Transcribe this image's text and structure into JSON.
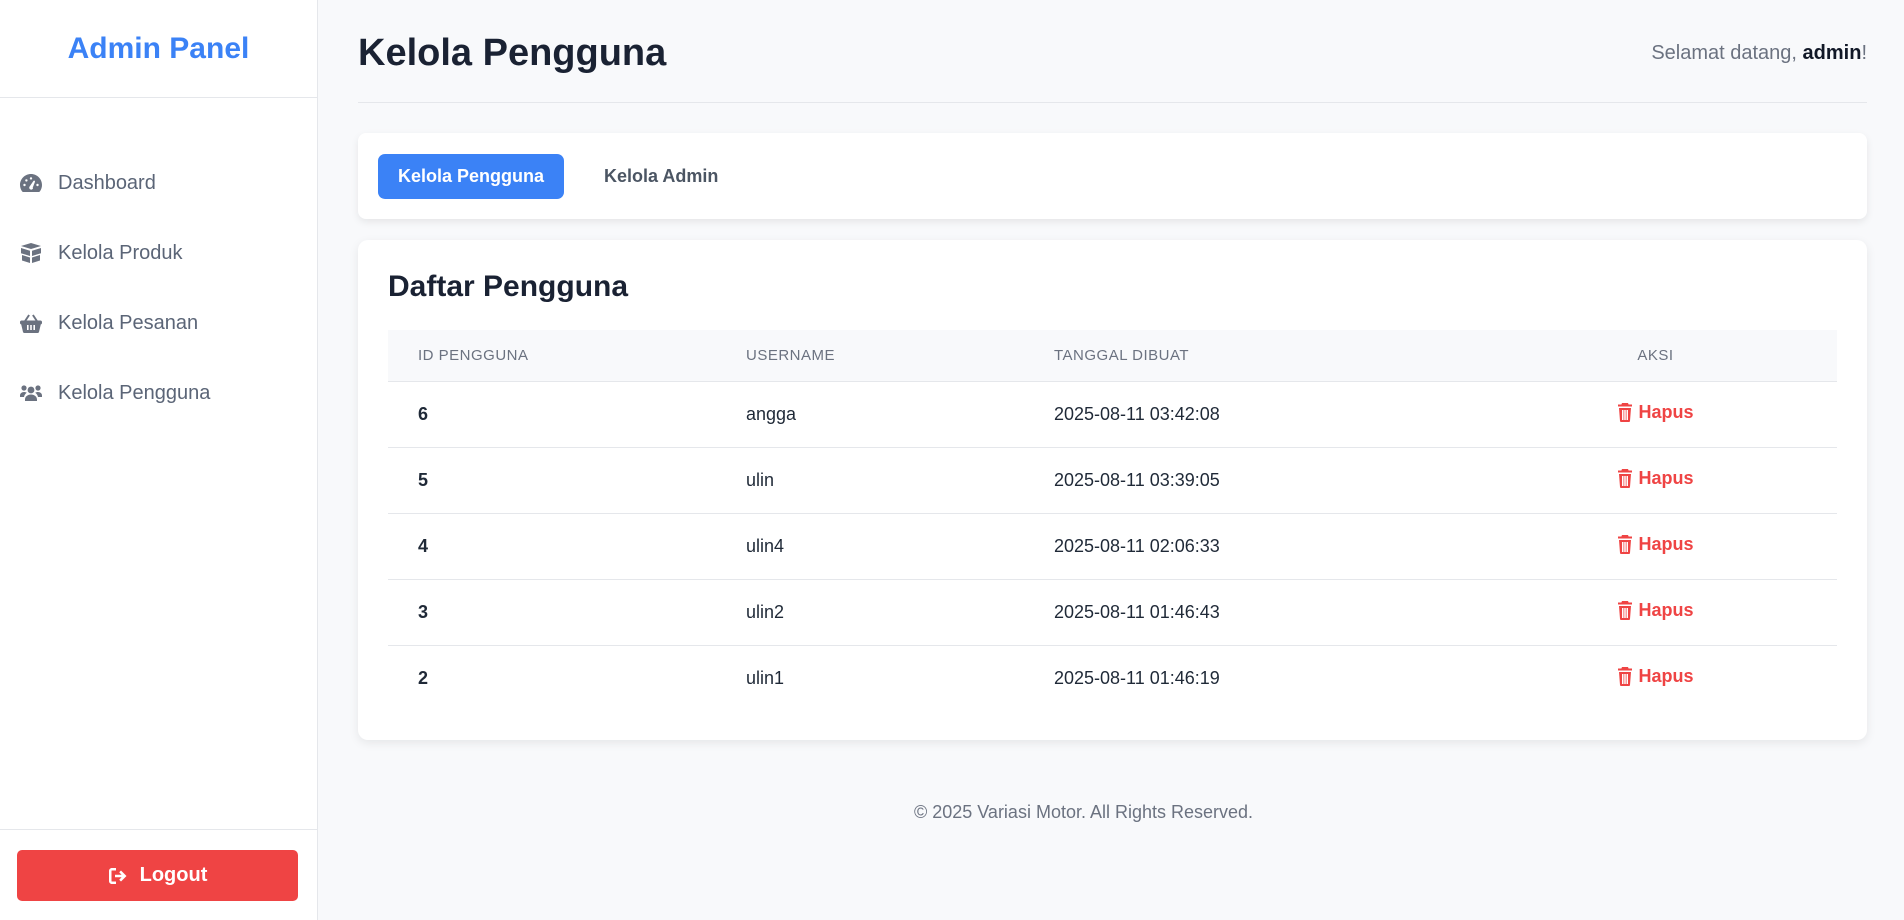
{
  "sidebar": {
    "brand": "Admin Panel",
    "items": [
      {
        "label": "Dashboard",
        "icon": "dashboard-gauge-icon"
      },
      {
        "label": "Kelola Produk",
        "icon": "box-icon"
      },
      {
        "label": "Kelola Pesanan",
        "icon": "shopping-basket-icon"
      },
      {
        "label": "Kelola Pengguna",
        "icon": "users-icon"
      }
    ],
    "logout_label": "Logout"
  },
  "header": {
    "title": "Kelola Pengguna",
    "welcome_prefix": "Selamat datang, ",
    "username": "admin",
    "welcome_suffix": "!"
  },
  "tabs": [
    {
      "label": "Kelola Pengguna",
      "active": true
    },
    {
      "label": "Kelola Admin",
      "active": false
    }
  ],
  "table": {
    "title": "Daftar Pengguna",
    "columns": [
      "ID PENGGUNA",
      "USERNAME",
      "TANGGAL DIBUAT",
      "AKSI"
    ],
    "rows": [
      {
        "id": "6",
        "username": "angga",
        "created": "2025-08-11 03:42:08",
        "action": "Hapus"
      },
      {
        "id": "5",
        "username": "ulin",
        "created": "2025-08-11 03:39:05",
        "action": "Hapus"
      },
      {
        "id": "4",
        "username": "ulin4",
        "created": "2025-08-11 02:06:33",
        "action": "Hapus"
      },
      {
        "id": "3",
        "username": "ulin2",
        "created": "2025-08-11 01:46:43",
        "action": "Hapus"
      },
      {
        "id": "2",
        "username": "ulin1",
        "created": "2025-08-11 01:46:19",
        "action": "Hapus"
      }
    ]
  },
  "footer": {
    "text": "© 2025 Variasi Motor. All Rights Reserved."
  },
  "colors": {
    "accent": "#3b82f6",
    "danger": "#ef4444"
  }
}
